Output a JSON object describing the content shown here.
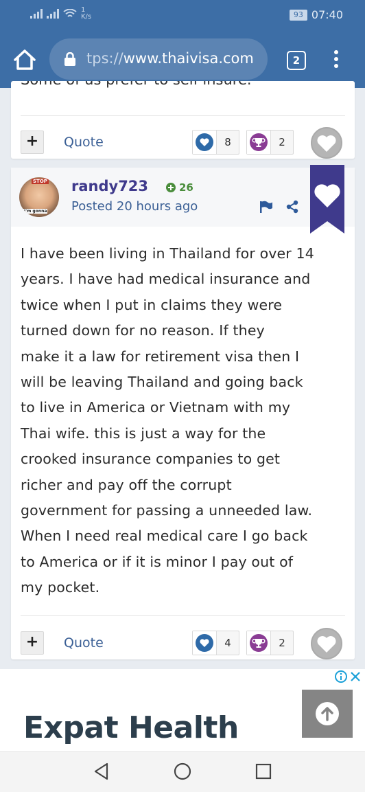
{
  "status_bar": {
    "network_speed": "1\nK/s",
    "battery": "93",
    "time": "07:40"
  },
  "browser": {
    "url_prefix": "tps://",
    "url_domain": "www.thaivisa.com",
    "tab_count": "2"
  },
  "previous_post": {
    "cut_text": "Some of us prefer to self-insure.",
    "quote_label": "Quote",
    "like_count": "8",
    "trophy_count": "2"
  },
  "post": {
    "username": "randy723",
    "reputation": "26",
    "posted": "Posted 20 hours ago",
    "avatar_stop": "STOP",
    "avatar_caption": "I'm gonna",
    "body_lines": [
      "I have been living in Thailand for over 14",
      "years. I have had medical insurance and",
      "twice when I put in claims they were",
      "turned down for no reason. If they",
      "make it a law for retirement visa then I",
      "will be leaving Thailand and going back",
      "to live in America or Vietnam with my",
      "Thai wife. this is just a way for the",
      "crooked insurance companies to get",
      "richer and pay off the corrupt",
      "government for passing a unneeded law.",
      "When I need real medical care I go back",
      "to America or if it is minor I pay out of",
      "my pocket."
    ],
    "quote_label": "Quote",
    "like_count": "4",
    "trophy_count": "2"
  },
  "ad": {
    "title": "Expat Health"
  },
  "colors": {
    "browser_bar": "#3d6ea6",
    "username": "#3f3a8c",
    "ribbon": "#3f3a8c",
    "link": "#3a5f95",
    "reputation": "#4a8d3c",
    "trophy": "#8a3c94",
    "like": "#2e6aa8"
  }
}
